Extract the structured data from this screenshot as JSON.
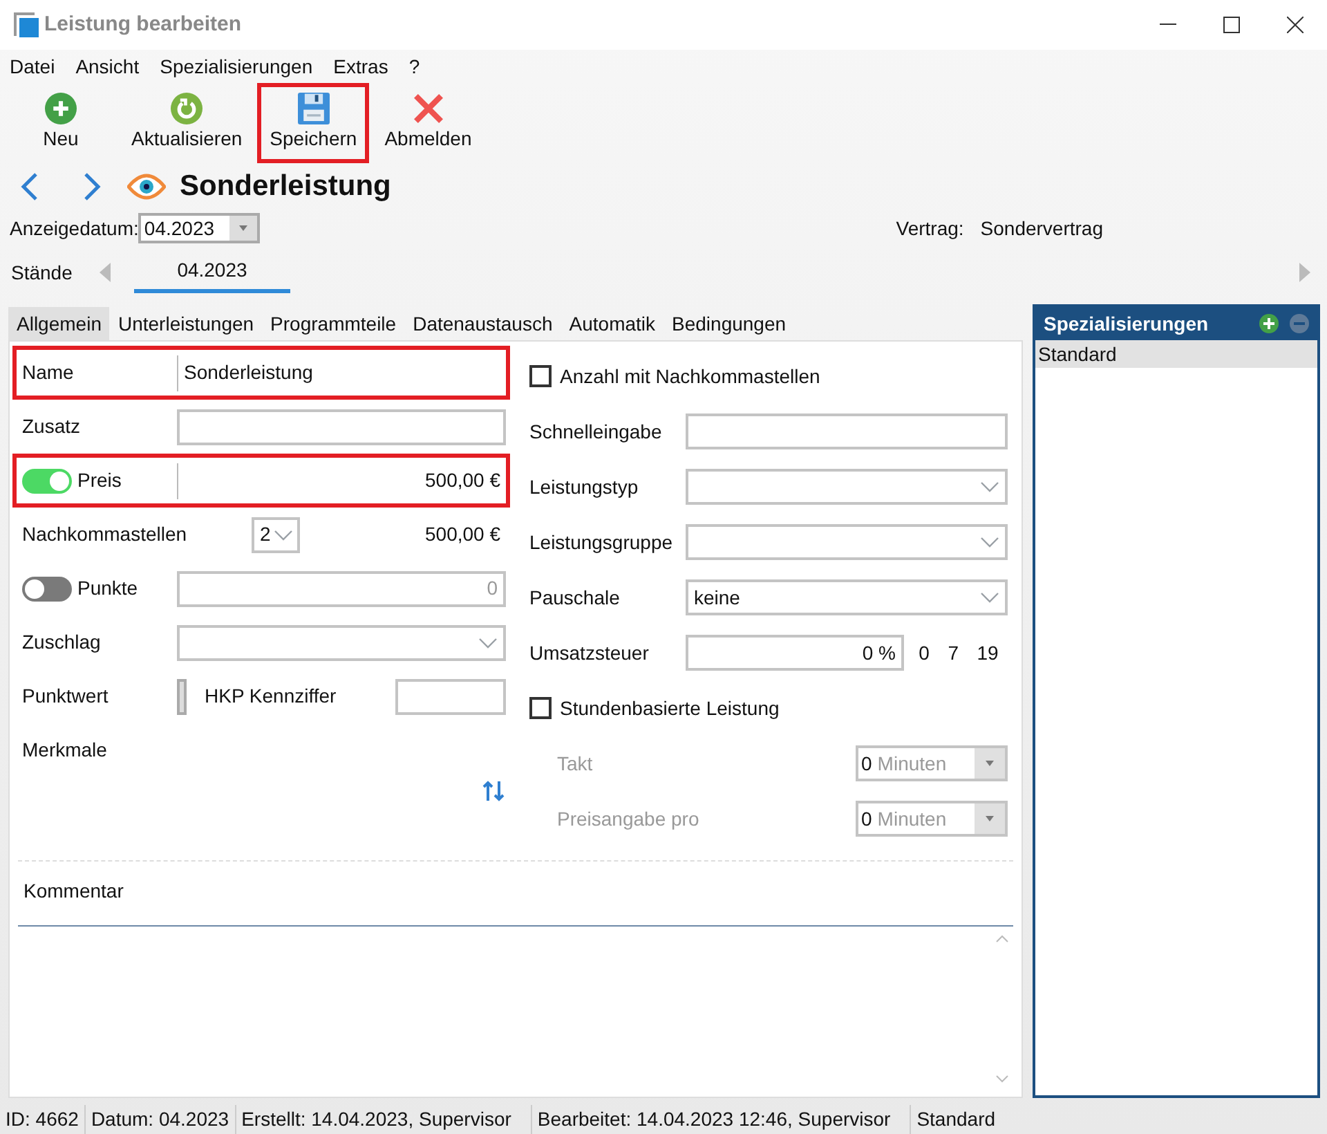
{
  "window": {
    "title": "Leistung bearbeiten"
  },
  "menu": [
    "Datei",
    "Ansicht",
    "Spezialisierungen",
    "Extras",
    "?"
  ],
  "toolbar": [
    {
      "kind": "new",
      "label": "Neu",
      "highlighted": false
    },
    {
      "kind": "refresh",
      "label": "Aktualisieren",
      "highlighted": false
    },
    {
      "kind": "save",
      "label": "Speichern",
      "highlighted": true
    },
    {
      "kind": "logout",
      "label": "Abmelden",
      "highlighted": false
    }
  ],
  "heading": "Sonderleistung",
  "display_date": {
    "label": "Anzeigedatum:",
    "value": "04.2023"
  },
  "contract": {
    "label": "Vertrag:",
    "value": "Sondervertrag"
  },
  "versions": {
    "label": "Stände",
    "tabs": [
      {
        "label": "04.2023",
        "selected": true
      }
    ]
  },
  "tabs": [
    {
      "label": "Allgemein",
      "selected": true
    },
    {
      "label": "Unterleistungen",
      "selected": false
    },
    {
      "label": "Programmteile",
      "selected": false
    },
    {
      "label": "Datenaustausch",
      "selected": false
    },
    {
      "label": "Automatik",
      "selected": false
    },
    {
      "label": "Bedingungen",
      "selected": false
    }
  ],
  "left_fields": [
    {
      "kind": "text",
      "label": "Name",
      "value": "Sonderleistung",
      "highlighted": true
    },
    {
      "kind": "text",
      "label": "Zusatz",
      "highlighted": false
    },
    {
      "kind": "toggle",
      "label": "Preis",
      "on": true,
      "value": "500,00 €",
      "highlighted": true
    },
    {
      "kind": "decimals",
      "label": "Nachkommastellen",
      "value": "2",
      "reading": "500,00 €"
    },
    {
      "kind": "toggle",
      "label": "Punkte",
      "on": false,
      "value": "0",
      "highlighted": false
    },
    {
      "kind": "select",
      "label": "Zuschlag"
    },
    {
      "kind": "pair",
      "label": "Punktwert",
      "second_label": "HKP Kennziffer"
    },
    {
      "kind": "label",
      "label": "Merkmale"
    }
  ],
  "right_fields": [
    {
      "kind": "checkbox",
      "label": "Anzahl mit Nachkommastellen",
      "checked": false
    },
    {
      "kind": "text",
      "label": "Schnelleingabe"
    },
    {
      "kind": "select",
      "label": "Leistungstyp"
    },
    {
      "kind": "select",
      "label": "Leistungsgruppe"
    },
    {
      "kind": "select",
      "label": "Pauschale",
      "value": "keine"
    },
    {
      "kind": "percent",
      "label": "Umsatzsteuer",
      "value": "0 %",
      "options": [
        "0",
        "7",
        "19"
      ]
    },
    {
      "kind": "checkbox",
      "label": "Stundenbasierte Leistung",
      "checked": false
    },
    {
      "kind": "minutes",
      "label": "Takt",
      "value": "0",
      "unit": "Minuten",
      "disabled": true
    },
    {
      "kind": "minutes",
      "label": "Preisangabe pro",
      "value": "0",
      "unit": "Minuten",
      "disabled": true
    }
  ],
  "comment": {
    "label": "Kommentar"
  },
  "specializations": {
    "title": "Spezialisierungen",
    "items": [
      {
        "label": "Standard",
        "selected": true
      }
    ]
  },
  "status_bar": [
    "ID: 4662",
    "Datum: 04.2023",
    "Erstellt: 14.04.2023, Supervisor",
    "Bearbeitet: 14.04.2023 12:46, Supervisor",
    "Standard"
  ]
}
